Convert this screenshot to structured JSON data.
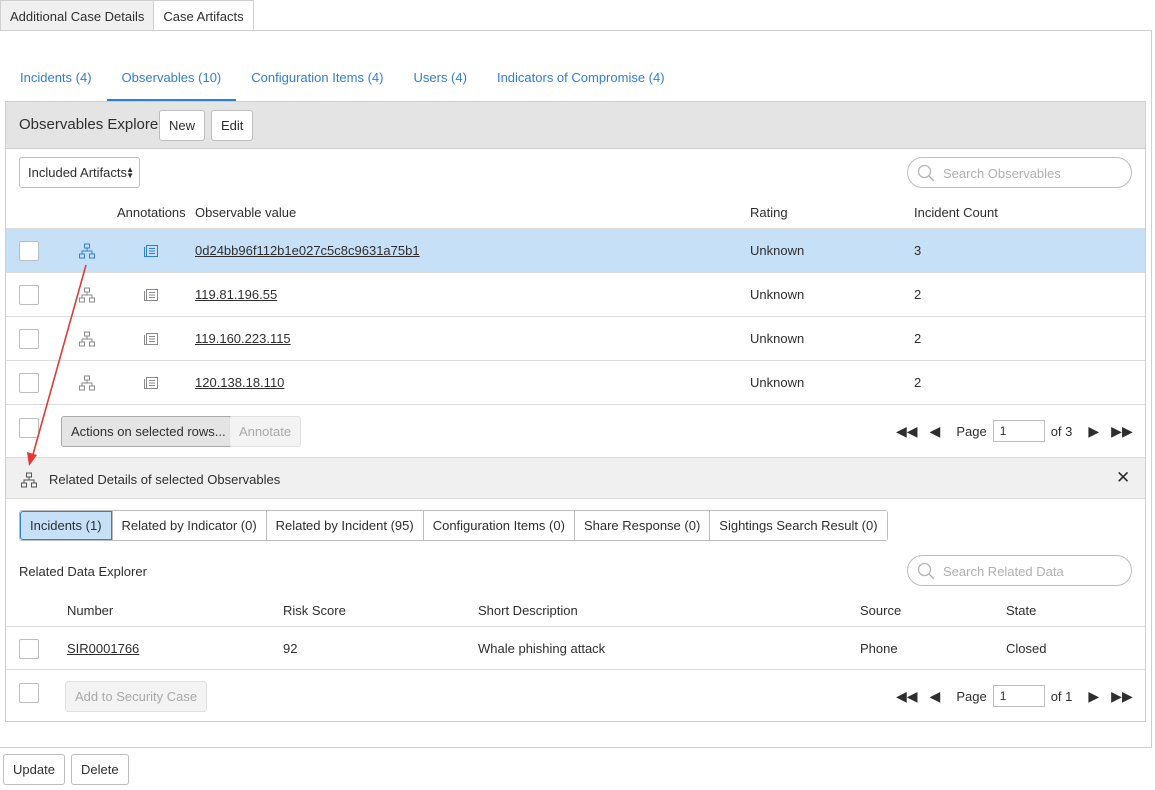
{
  "top_tabs": [
    {
      "label": "Additional Case Details",
      "active": false
    },
    {
      "label": "Case Artifacts",
      "active": true
    }
  ],
  "sub_tabs": [
    {
      "label": "Incidents (4)",
      "active": false
    },
    {
      "label": "Observables (10)",
      "active": true
    },
    {
      "label": "Configuration Items (4)",
      "active": false
    },
    {
      "label": "Users (4)",
      "active": false
    },
    {
      "label": "Indicators of Compromise (4)",
      "active": false
    }
  ],
  "explorer": {
    "title": "Observables Explorer",
    "new_label": "New",
    "edit_label": "Edit",
    "filter_selected": "Included Artifacts",
    "search_placeholder": "Search Observables",
    "columns": [
      "Annotations",
      "Observable value",
      "Rating",
      "Incident Count"
    ],
    "rows": [
      {
        "value": "0d24bb96f112b1e027c5c8c9631a75b1",
        "rating": "Unknown",
        "count": "3",
        "selected": true
      },
      {
        "value": "119.81.196.55",
        "rating": "Unknown",
        "count": "2",
        "selected": false
      },
      {
        "value": "119.160.223.115",
        "rating": "Unknown",
        "count": "2",
        "selected": false
      },
      {
        "value": "120.138.18.110",
        "rating": "Unknown",
        "count": "2",
        "selected": false
      }
    ],
    "actions_label": "Actions on selected rows...",
    "annotate_label": "Annotate",
    "pager": {
      "page_label": "Page",
      "page": "1",
      "of_label": "of 3"
    }
  },
  "related": {
    "title": "Related Details of selected Observables",
    "close_glyph": "✕",
    "tabs": [
      {
        "label": "Incidents (1)",
        "active": true
      },
      {
        "label": "Related by Indicator (0)",
        "active": false
      },
      {
        "label": "Related by Incident (95)",
        "active": false
      },
      {
        "label": "Configuration Items (0)",
        "active": false
      },
      {
        "label": "Share Response (0)",
        "active": false
      },
      {
        "label": "Sightings Search Result (0)",
        "active": false
      }
    ],
    "explorer_label": "Related Data Explorer",
    "search_placeholder": "Search Related Data",
    "columns": [
      "Number",
      "Risk Score",
      "Short Description",
      "Source",
      "State"
    ],
    "rows": [
      {
        "number": "SIR0001766",
        "risk": "92",
        "desc": "Whale phishing attack",
        "source": "Phone",
        "state": "Closed"
      }
    ],
    "add_label": "Add to Security Case",
    "pager": {
      "page_label": "Page",
      "page": "1",
      "of_label": "of 1"
    }
  },
  "footer": {
    "update_label": "Update",
    "delete_label": "Delete"
  },
  "nav_glyphs": {
    "first": "◀◀",
    "prev": "◀",
    "next": "▶",
    "last": "▶▶",
    "caret_up": "▲",
    "caret_down": "▼"
  },
  "colors": {
    "accent": "#2f7fd7",
    "selected_row": "#c6e0f7",
    "header_bg": "#e4e4e4",
    "arrow": "#e53935"
  }
}
